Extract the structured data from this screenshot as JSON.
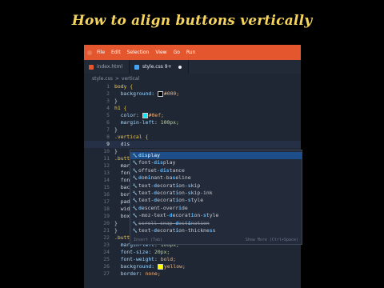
{
  "video_title": "How to align buttons vertically",
  "menu": [
    "File",
    "Edit",
    "Selection",
    "View",
    "Go",
    "Run"
  ],
  "tabs": [
    {
      "label": "index.html",
      "active": false,
      "icon_color": "#e4572e"
    },
    {
      "label": "style.css 9+",
      "active": true,
      "icon_color": "#42a5f5",
      "modified": true
    }
  ],
  "breadcrumb": {
    "file": "style.css",
    "separator": ">",
    "symbol": "vertical"
  },
  "code_lines": [
    {
      "n": "1",
      "text": "body {"
    },
    {
      "n": "2",
      "text": "  background: #000;"
    },
    {
      "n": "3",
      "text": "}"
    },
    {
      "n": "4",
      "text": "h1 {"
    },
    {
      "n": "5",
      "text": "  color: #0ef;"
    },
    {
      "n": "6",
      "text": "  margin-left: 100px;"
    },
    {
      "n": "7",
      "text": "}"
    },
    {
      "n": "8",
      "text": ".vertical {"
    },
    {
      "n": "9",
      "text": "  dis"
    },
    {
      "n": "10",
      "text": "}"
    },
    {
      "n": "11",
      "text": ".butt"
    },
    {
      "n": "12",
      "text": "  mar"
    },
    {
      "n": "13",
      "text": "  fon"
    },
    {
      "n": "14",
      "text": "  fon"
    },
    {
      "n": "15",
      "text": "  bac"
    },
    {
      "n": "16",
      "text": "  bor"
    },
    {
      "n": "17",
      "text": "  pad"
    },
    {
      "n": "18",
      "text": "  wid"
    },
    {
      "n": "19",
      "text": "  box"
    },
    {
      "n": "20",
      "text": "}"
    },
    {
      "n": "21",
      "text": "}"
    },
    {
      "n": "22",
      "text": ".button2 {"
    },
    {
      "n": "23",
      "text": "  margin-left: 100px;"
    },
    {
      "n": "24",
      "text": "  font-size: 20px;"
    },
    {
      "n": "25",
      "text": "  font-weight: bold;"
    },
    {
      "n": "26",
      "text": "  background: yellow;"
    },
    {
      "n": "27",
      "text": "  border: none;"
    }
  ],
  "swatches": {
    "line2": "#000000",
    "line5": "#00eeff",
    "line26": "#ffff00"
  },
  "suggestions": [
    "display",
    "font-display",
    "offset-distance",
    "dominant-baseline",
    "text-decoration-skip",
    "text-decoration-skip-ink",
    "text-decoration-style",
    "descent-override",
    "-moz-text-decoration-style",
    "scroll-snap-destination",
    "text-decoration-thickness"
  ],
  "suggest_footer": {
    "left": "Insert (Tab)",
    "right": "Show More (Ctrl+Space)"
  }
}
